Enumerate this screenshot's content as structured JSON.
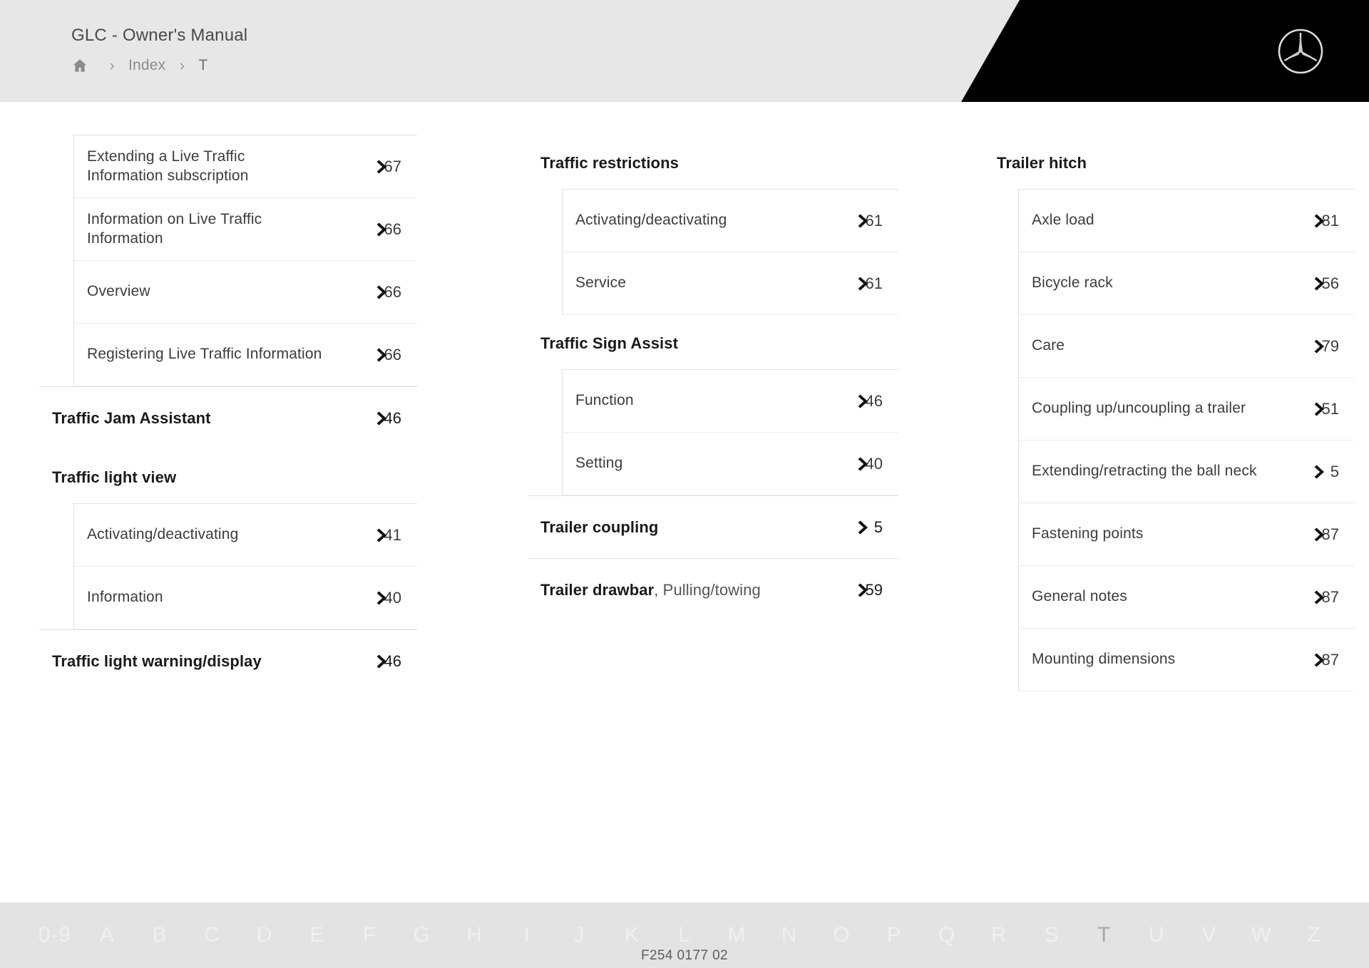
{
  "header": {
    "manual_title": "GLC - Owner's Manual",
    "breadcrumb": {
      "home_icon": "home-icon",
      "separator": "›",
      "items": [
        {
          "label": "Index",
          "current": false
        },
        {
          "label": "T",
          "current": true
        }
      ]
    },
    "brand_logo": "mercedes-benz-star-icon"
  },
  "columns": [
    {
      "id": "column-1",
      "groups": [
        {
          "heading": null,
          "items": [
            {
              "label": "Extending a Live Traffic Information subscription",
              "page": "6",
              "page_suffix": "7",
              "chevron": "chevron-right-icon"
            },
            {
              "label": "Information on Live Traffic Information",
              "page": "6",
              "page_suffix": "6",
              "chevron": "chevron-right-icon"
            },
            {
              "label": "Overview",
              "page": "6",
              "page_suffix": "6",
              "chevron": "chevron-right-icon"
            },
            {
              "label": "Registering Live Traffic Information",
              "page": "6",
              "page_suffix": "6",
              "chevron": "chevron-right-icon"
            }
          ]
        },
        {
          "heading": {
            "label": "Traffic Jam Assistant",
            "sub": null,
            "page": "4",
            "page_suffix": "6",
            "chevron": "chevron-right-icon"
          },
          "items": []
        },
        {
          "heading": {
            "label": "Traffic light view",
            "sub": null,
            "page": null,
            "page_suffix": null,
            "chevron": null
          },
          "items": [
            {
              "label": "Activating/deactivating",
              "page": "4",
              "page_suffix": "1",
              "chevron": "chevron-right-icon"
            },
            {
              "label": "Information",
              "page": "4",
              "page_suffix": "0",
              "chevron": "chevron-right-icon"
            }
          ]
        },
        {
          "heading": {
            "label": "Traffic light warning/display",
            "sub": null,
            "page": "4",
            "page_suffix": "6",
            "chevron": "chevron-right-icon"
          },
          "items": []
        }
      ]
    },
    {
      "id": "column-2",
      "groups": [
        {
          "heading": {
            "label": "Traffic restrictions",
            "sub": null,
            "page": null,
            "page_suffix": null,
            "chevron": null
          },
          "items": [
            {
              "label": "Activating/deactivating",
              "page": "6",
              "page_suffix": "1",
              "chevron": "chevron-right-icon"
            },
            {
              "label": "Service",
              "page": "6",
              "page_suffix": "1",
              "chevron": "chevron-right-icon"
            }
          ]
        },
        {
          "heading": {
            "label": "Traffic Sign Assist",
            "sub": null,
            "page": null,
            "page_suffix": null,
            "chevron": null
          },
          "items": [
            {
              "label": "Function",
              "page": "4",
              "page_suffix": "6",
              "chevron": "chevron-right-icon"
            },
            {
              "label": "Setting",
              "page": "4",
              "page_suffix": "0",
              "chevron": "chevron-right-icon"
            }
          ]
        },
        {
          "heading": {
            "label": "Trailer coupling",
            "sub": null,
            "page": "5",
            "page_suffix": "",
            "chevron": "chevron-right-icon"
          },
          "items": []
        },
        {
          "heading": {
            "label": "Trailer drawbar",
            "sub": ", Pulling/towing",
            "page": "5",
            "page_suffix": "9",
            "chevron": "chevron-right-icon"
          },
          "items": []
        }
      ]
    },
    {
      "id": "column-3",
      "groups": [
        {
          "heading": {
            "label": "Trailer hitch",
            "sub": null,
            "page": null,
            "page_suffix": null,
            "chevron": null
          },
          "items": [
            {
              "label": "Axle load",
              "page": "8",
              "page_suffix": "1",
              "chevron": "chevron-right-icon"
            },
            {
              "label": "Bicycle rack",
              "page": "5",
              "page_suffix": "6",
              "chevron": "chevron-right-icon"
            },
            {
              "label": "Care",
              "page": "7",
              "page_suffix": "9",
              "chevron": "chevron-right-icon"
            },
            {
              "label": "Coupling up/uncoupling a trailer",
              "page": "5",
              "page_suffix": "1",
              "chevron": "chevron-right-icon"
            },
            {
              "label": "Extending/retracting the ball neck",
              "page": "5",
              "page_suffix": "",
              "chevron": "chevron-right-icon"
            },
            {
              "label": "Fastening points",
              "page": "8",
              "page_suffix": "7",
              "chevron": "chevron-right-icon"
            },
            {
              "label": "General notes",
              "page": "8",
              "page_suffix": "7",
              "chevron": "chevron-right-icon"
            },
            {
              "label": "Mounting dimensions",
              "page": "8",
              "page_suffix": "7",
              "chevron": "chevron-right-icon"
            }
          ]
        }
      ]
    }
  ],
  "footer": {
    "alphabet": [
      "0-9",
      "A",
      "B",
      "C",
      "D",
      "E",
      "F",
      "G",
      "H",
      "I",
      "J",
      "K",
      "L",
      "M",
      "N",
      "O",
      "P",
      "Q",
      "R",
      "S",
      "T",
      "U",
      "V",
      "W",
      "Z"
    ],
    "active_letter": "T",
    "document_code": "F254 0177 02"
  },
  "colors": {
    "header_bg": "#e7e7e7",
    "header_accent": "#000000",
    "content_bg": "#ffffff",
    "footer_bg": "#e3e3e3",
    "text_primary": "#1a1a1a",
    "text_secondary": "#3c3c3c",
    "divider": "#e2e2e2"
  }
}
